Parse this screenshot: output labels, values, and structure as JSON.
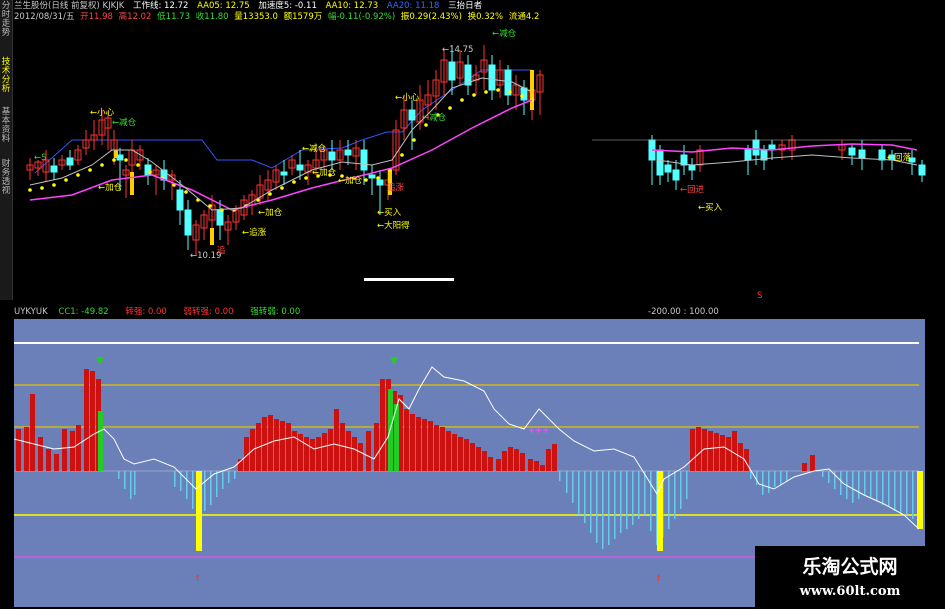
{
  "colors": {
    "up": "#ff3333",
    "down": "#54ffff",
    "ma_dots": "#ffff00",
    "ma_long": "#ff44ff",
    "ma_mid": "#c0c0c0",
    "line_blue": "#3355ff",
    "hist_red": "#cc1111",
    "hist_cyan": "#66ccee",
    "hist_yellow": "#ffff00",
    "hist_green": "#22cc22",
    "lower_bg": "#6b7fb8",
    "lower_white": "#ffffff",
    "gold": "#e6c200",
    "magenta": "#ff44ff"
  },
  "sidebar": {
    "tabs": [
      "分时走势",
      "技术分析",
      "基本资料",
      "财务透视"
    ],
    "active": 1
  },
  "header": {
    "line1": [
      {
        "t": "兰生股份(日线 前复权) KJKJK",
        "c": "#c8c8c8"
      },
      {
        "t": "工作线: 12.72",
        "c": "#ffffff"
      },
      {
        "t": "AA05: 12.75",
        "c": "#ffff00"
      },
      {
        "t": "加速度5: -0.11",
        "c": "#ffffff"
      },
      {
        "t": "AA10: 12.73",
        "c": "#ffff00"
      },
      {
        "t": "AA20: 11.18",
        "c": "#3366ff"
      },
      {
        "t": "三抬日者",
        "c": "#ffffff"
      }
    ],
    "line2": [
      {
        "t": "2012/08/31/五",
        "c": "#c8c8c8"
      },
      {
        "t": "开11.98",
        "c": "#ff4444"
      },
      {
        "t": "高12.02",
        "c": "#ff4444"
      },
      {
        "t": "低11.73",
        "c": "#33dd33"
      },
      {
        "t": "收11.80",
        "c": "#33dd33"
      },
      {
        "t": "量13353.0",
        "c": "#ffff00"
      },
      {
        "t": "额1579万",
        "c": "#ffff00"
      },
      {
        "t": "幅-0.11(-0.92%)",
        "c": "#33dd33"
      },
      {
        "t": "振0.29(2.43%)",
        "c": "#ffff00"
      },
      {
        "t": "换0.32%",
        "c": "#ffff00"
      },
      {
        "t": "流通4.2",
        "c": "#ffff00"
      }
    ]
  },
  "annotations": {
    "price_high": "14.75",
    "price_low": "10.19",
    "labels": [
      "←S",
      "←加仓",
      "←加仓",
      "←追涨",
      "←小心",
      "←减仓",
      "←减仓",
      "←加仓",
      "←加仓",
      "←小心",
      "←减仓",
      "←买入",
      "←大阳得",
      "←追涨",
      "←买入",
      "←回进",
      "←减仓",
      "←回落",
      "S",
      "←S"
    ]
  },
  "indicator": {
    "name": "UYKYUK",
    "fields": [
      {
        "t": "CC1: -49.82",
        "c": "#33dd33"
      },
      {
        "t": "转强: 0.00",
        "c": "#ff3333"
      },
      {
        "t": "弱转强: 0.00",
        "c": "#ff3333"
      },
      {
        "t": "强转弱: 0.00",
        "c": "#33dd33"
      }
    ],
    "right_values": "-200.00 : 100.00"
  },
  "watermark": {
    "title": "乐淘公式网",
    "url": "www.60lt.com"
  }
}
